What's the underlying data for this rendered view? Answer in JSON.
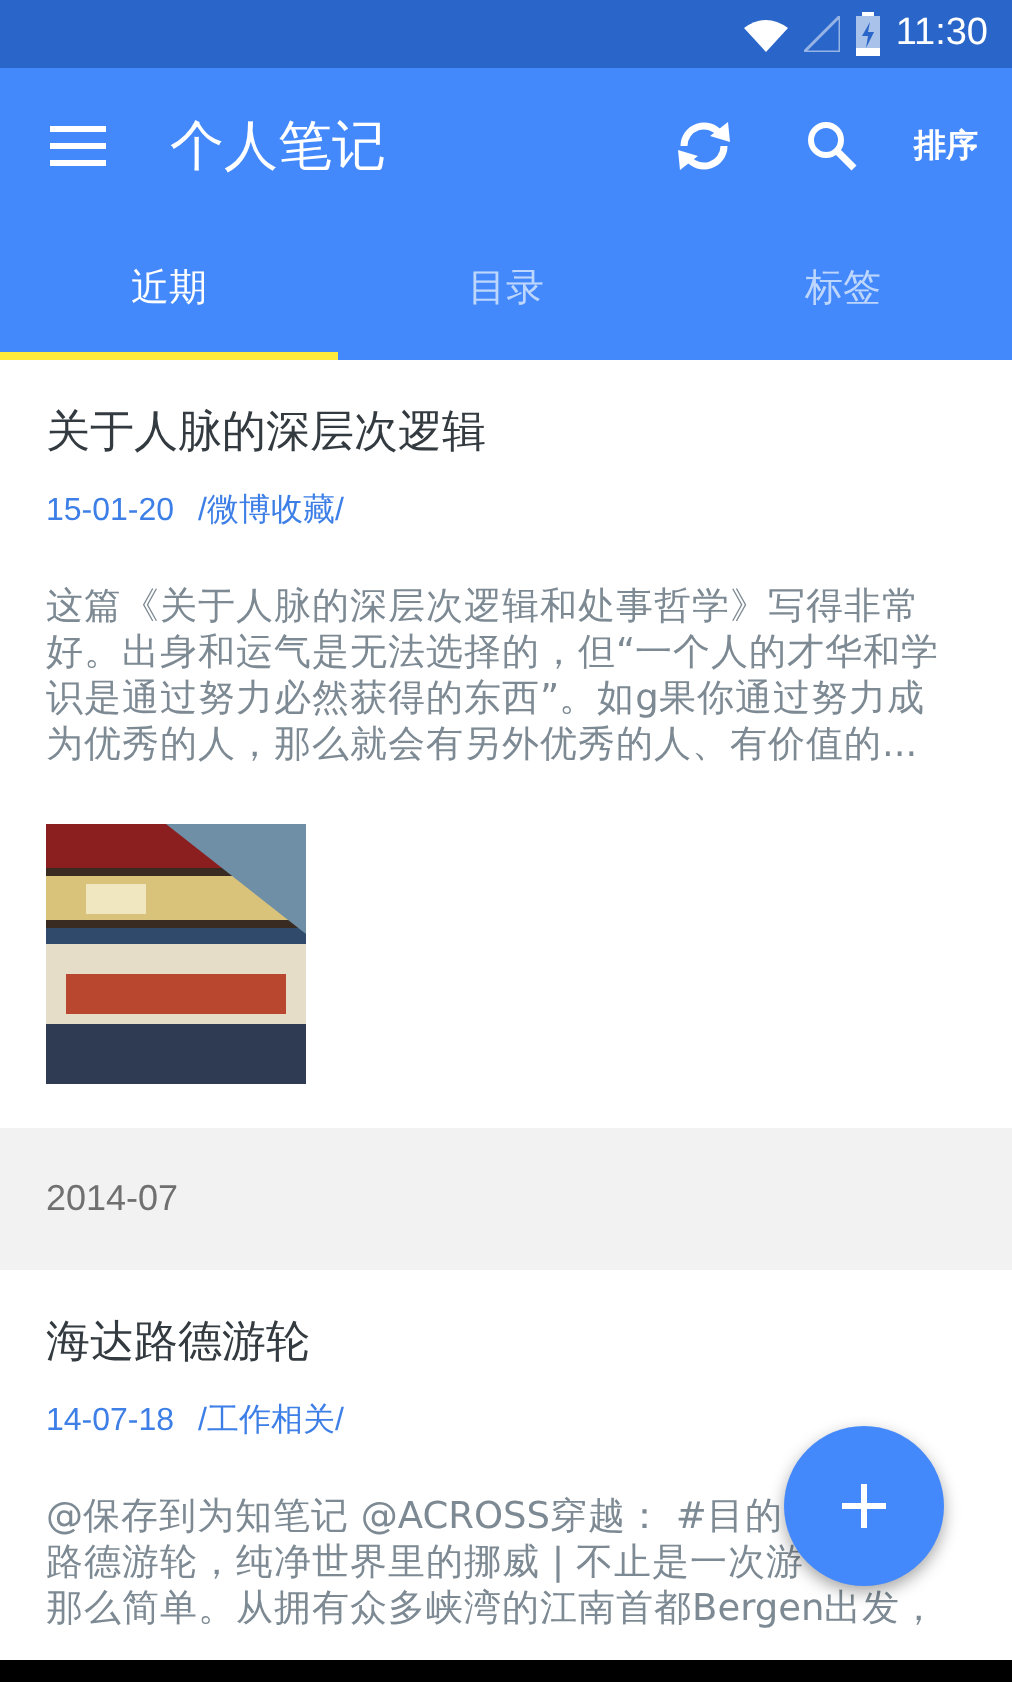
{
  "status_bar": {
    "time": "11:30"
  },
  "toolbar": {
    "title": "个人笔记",
    "sort_label": "排序"
  },
  "tabs": [
    {
      "label": "近期",
      "selected": true
    },
    {
      "label": "目录",
      "selected": false
    },
    {
      "label": "标签",
      "selected": false
    }
  ],
  "sections": [
    {
      "notes": [
        {
          "title": "关于人脉的深层次逻辑",
          "date": "15-01-20",
          "folder": "/微博收藏/",
          "excerpt_lines": [
            "这篇《关于人脉的深层次逻辑和处事哲学》写得非常",
            "好。出身和运气是无法选择的，但“一个人的才华和学",
            "识是通过努力必然获得的东西”。如g果你通过努力成",
            "为优秀的人，那么就会有另外优秀的人、有价值的..."
          ]
        }
      ]
    },
    {
      "header": "2014-07",
      "notes": [
        {
          "title": "海达路德游轮",
          "date": "14-07-18",
          "folder": "/工作相关/",
          "excerpt_lines": [
            "@保存到为知笔记 @ACROSS穿越： #目的",
            "路德游轮，纯净世界里的挪威 | 不止是一次游",
            "那么简单。从拥有众多峡湾的江南首都Bergen出发，"
          ]
        }
      ]
    }
  ]
}
